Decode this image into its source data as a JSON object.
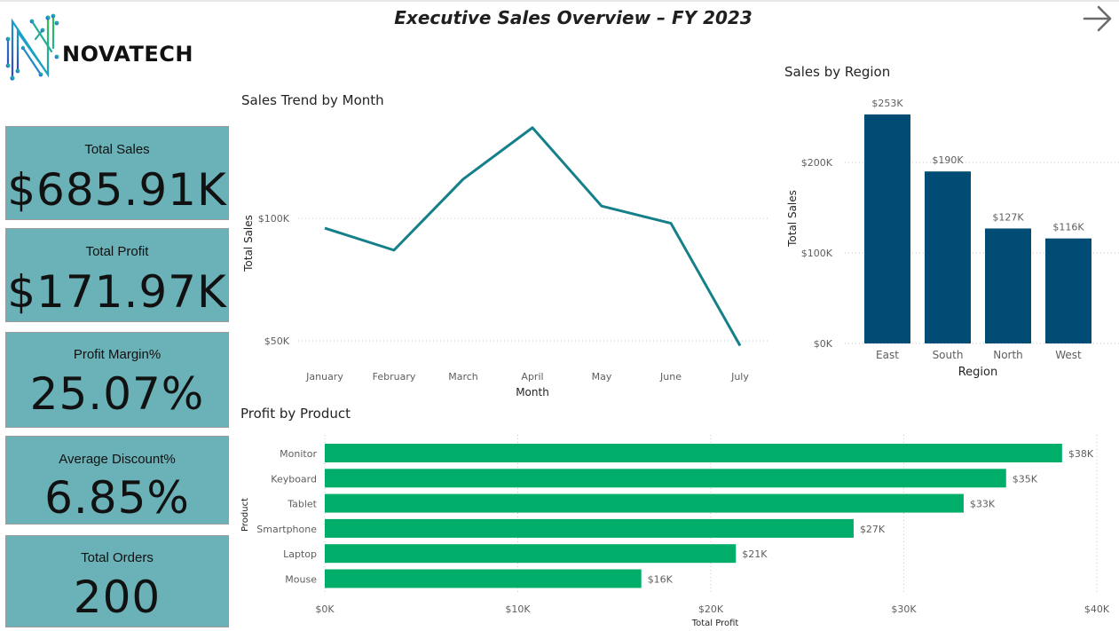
{
  "header": {
    "title": "Executive Sales Overview – FY 2023",
    "logo_text": "NOVATECH",
    "nav_icon": "arrow-right-icon"
  },
  "kpis": [
    {
      "label": "Total Sales",
      "value": "$685.91K"
    },
    {
      "label": "Total Profit",
      "value": "$171.97K"
    },
    {
      "label": "Profit Margin%",
      "value": "25.07%"
    },
    {
      "label": "Average Discount%",
      "value": "6.85%"
    },
    {
      "label": "Total Orders",
      "value": "200"
    }
  ],
  "colors": {
    "kpi_bg": "#6ab1b8",
    "line": "#16808a",
    "region_bar": "#004c74",
    "product_bar": "#00ad69"
  },
  "chart_data": [
    {
      "type": "line",
      "title": "Sales Trend by Month",
      "xlabel": "Month",
      "ylabel": "Total Sales",
      "categories": [
        "January",
        "February",
        "March",
        "April",
        "May",
        "June",
        "July"
      ],
      "values": [
        96000,
        87000,
        116000,
        137000,
        105000,
        98000,
        48000
      ],
      "y_ticks": [
        {
          "value": 50000,
          "label": "$50K"
        },
        {
          "value": 100000,
          "label": "$100K"
        }
      ],
      "ylim": [
        50000,
        100000
      ],
      "grid": true
    },
    {
      "type": "bar",
      "title": "Sales by Region",
      "xlabel": "Region",
      "ylabel": "Total Sales",
      "categories": [
        "East",
        "South",
        "North",
        "West"
      ],
      "values": [
        253000,
        190000,
        127000,
        116000
      ],
      "data_labels": [
        "$253K",
        "$190K",
        "$127K",
        "$116K"
      ],
      "y_ticks": [
        {
          "value": 0,
          "label": "$0K"
        },
        {
          "value": 100000,
          "label": "$100K"
        },
        {
          "value": 200000,
          "label": "$200K"
        }
      ],
      "ylim": [
        0,
        200000
      ],
      "grid": true
    },
    {
      "type": "bar",
      "orientation": "horizontal",
      "title": "Profit by Product",
      "xlabel": "Total Profit",
      "ylabel": "Product",
      "categories": [
        "Monitor",
        "Keyboard",
        "Tablet",
        "Smartphone",
        "Laptop",
        "Mouse"
      ],
      "values": [
        38200,
        35300,
        33100,
        27400,
        21300,
        16400
      ],
      "data_labels": [
        "$38K",
        "$35K",
        "$33K",
        "$27K",
        "$21K",
        "$16K"
      ],
      "x_ticks": [
        {
          "value": 0,
          "label": "$0K"
        },
        {
          "value": 10000,
          "label": "$10K"
        },
        {
          "value": 20000,
          "label": "$20K"
        },
        {
          "value": 30000,
          "label": "$30K"
        },
        {
          "value": 40000,
          "label": "$40K"
        }
      ],
      "xlim": [
        0,
        40000
      ],
      "grid": true
    }
  ]
}
